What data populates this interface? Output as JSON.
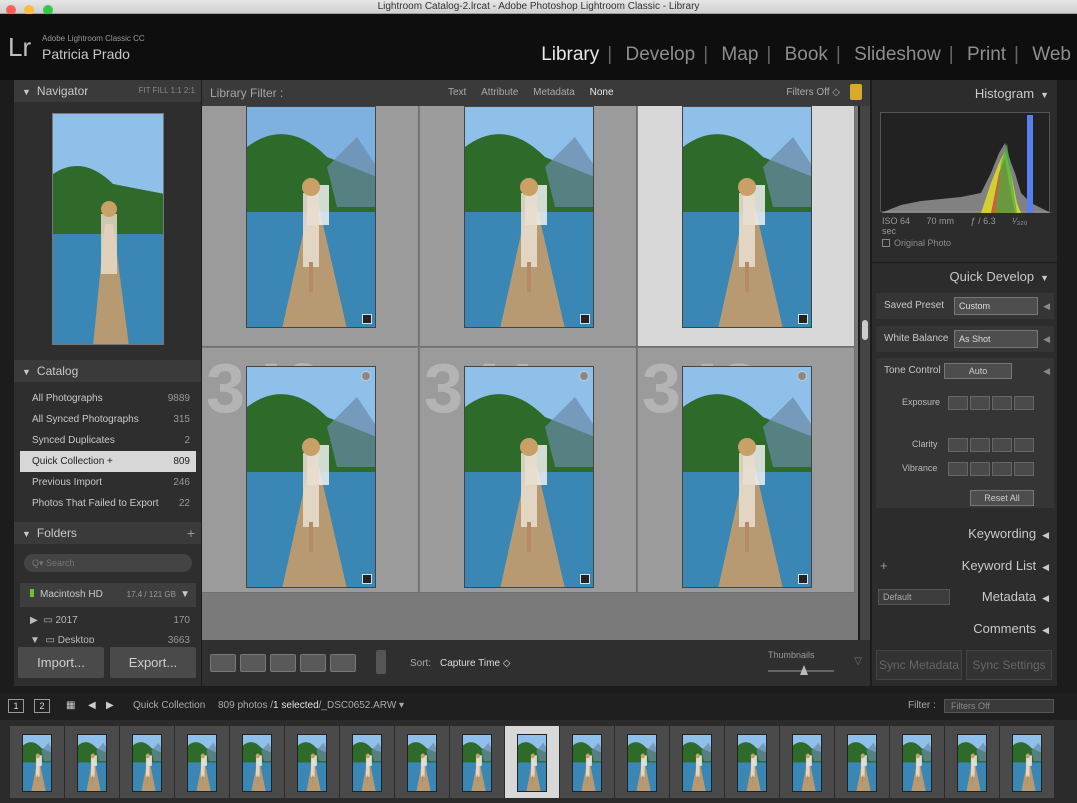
{
  "window": {
    "title": "Lightroom Catalog-2.lrcat - Adobe Photoshop Lightroom Classic - Library"
  },
  "header": {
    "logo": "Lr",
    "product": "Adobe Lightroom Classic CC",
    "user": "Patricia Prado",
    "modules": [
      "Library",
      "Develop",
      "Map",
      "Book",
      "Slideshow",
      "Print",
      "Web"
    ],
    "active_module": "Library"
  },
  "navigator": {
    "title": "Navigator",
    "options": "FIT  FILL  1:1  2:1"
  },
  "catalog": {
    "title": "Catalog",
    "items": [
      {
        "label": "All Photographs",
        "count": "9889"
      },
      {
        "label": "All Synced Photographs",
        "count": "315"
      },
      {
        "label": "Synced Duplicates",
        "count": "2"
      },
      {
        "label": "Quick Collection +",
        "count": "809"
      },
      {
        "label": "Previous Import",
        "count": "246"
      },
      {
        "label": "Photos That Failed to Export",
        "count": "22"
      }
    ],
    "selected_index": 3
  },
  "folders": {
    "title": "Folders",
    "search_placeholder": "Q▾ Search",
    "volume": {
      "name": "Macintosh HD",
      "size": "17.4 / 121 GB"
    },
    "items": [
      {
        "label": "2017",
        "count": "170"
      },
      {
        "label": "Desktop",
        "count": "3663"
      }
    ]
  },
  "left_buttons": {
    "import": "Import...",
    "export": "Export..."
  },
  "filter_bar": {
    "label": "Library Filter :",
    "tabs": [
      "Text",
      "Attribute",
      "Metadata",
      "None"
    ],
    "active_tab": "None",
    "filters_off": "Filters Off ◇"
  },
  "grid": {
    "cells": [
      {
        "num": "",
        "sky": "#7fb1e0",
        "selected": false
      },
      {
        "num": "",
        "sky": "#8fc0ea",
        "selected": false
      },
      {
        "num": "",
        "sky": "#8fc0ea",
        "selected": true
      },
      {
        "num": "340",
        "sky": "#8fc0ea",
        "selected": false
      },
      {
        "num": "341",
        "sky": "#8fc0ea",
        "selected": false
      },
      {
        "num": "342",
        "sky": "#8fc0ea",
        "selected": false
      }
    ]
  },
  "toolbar": {
    "sort_label": "Sort:",
    "sort_value": "Capture Time ◇",
    "thumbnails_label": "Thumbnails"
  },
  "histogram": {
    "title": "Histogram",
    "iso": "ISO 64",
    "focal": "70 mm",
    "aperture": "ƒ / 6.3",
    "shutter": "¹⁄₃₂₀ sec",
    "original_photo": "Original Photo"
  },
  "quick_develop": {
    "title": "Quick Develop",
    "saved_preset_label": "Saved Preset",
    "saved_preset_value": "Custom",
    "white_balance_label": "White Balance",
    "white_balance_value": "As Shot",
    "tone_control_label": "Tone Control",
    "auto_label": "Auto",
    "exposure_label": "Exposure",
    "clarity_label": "Clarity",
    "vibrance_label": "Vibrance",
    "reset_label": "Reset All"
  },
  "right_sections": {
    "keywording": "Keywording",
    "keyword_list": "Keyword List",
    "metadata": "Metadata",
    "metadata_preset": "Default",
    "comments": "Comments"
  },
  "sync": {
    "metadata": "Sync Metadata",
    "settings": "Sync Settings"
  },
  "filmstrip_bar": {
    "monitor1": "1",
    "monitor2": "2",
    "source": "Quick Collection",
    "info_prefix": "809 photos /",
    "info_selected": "1 selected",
    "info_file": "/_DSC0652.ARW ▾",
    "filter_label": "Filter :",
    "filter_value": "Filters Off"
  },
  "filmstrip": {
    "count": 19,
    "selected_index": 9
  },
  "colors": {
    "lock": "#d9a92b",
    "selected_cell": "#d8d8d8",
    "volume_led": "#6cbf3a"
  }
}
